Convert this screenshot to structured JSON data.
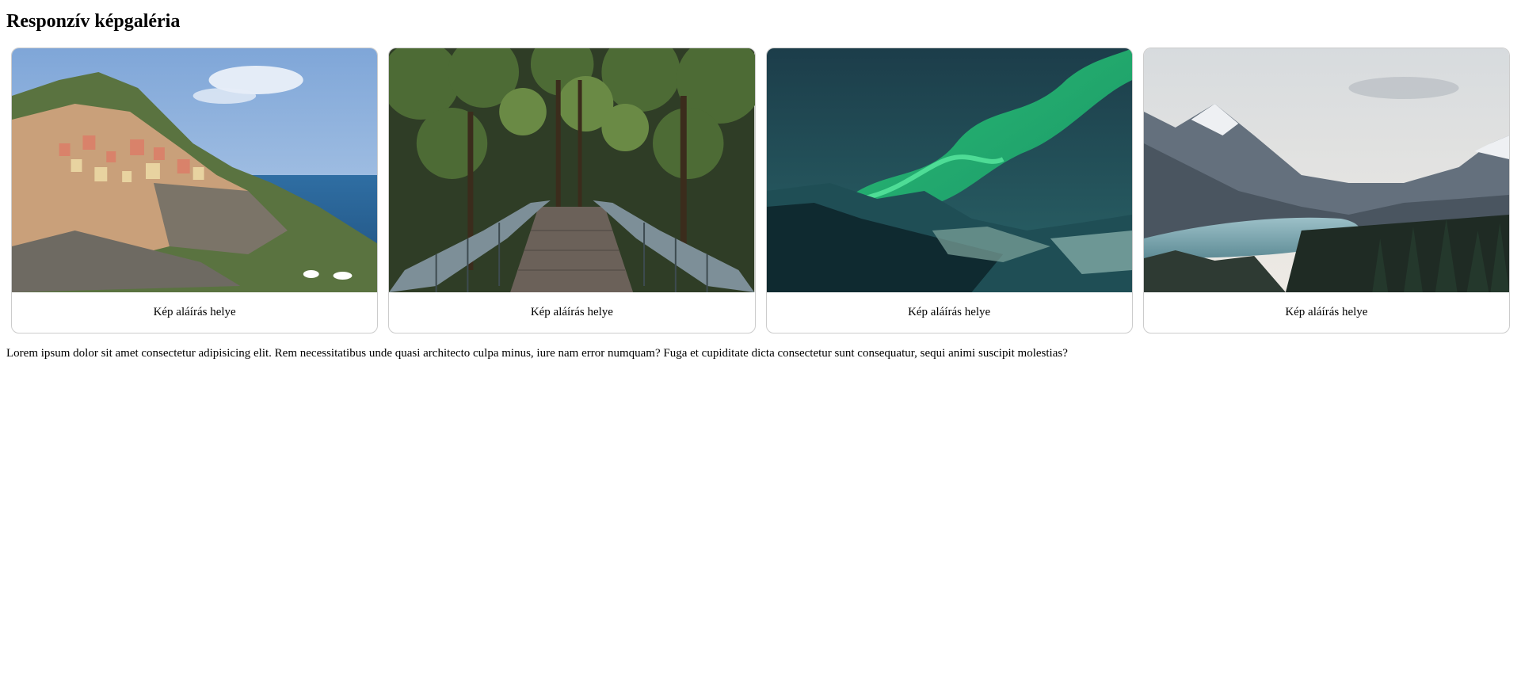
{
  "page": {
    "title": "Responzív képgaléria"
  },
  "gallery": {
    "items": [
      {
        "image": "coastal-village-photo",
        "caption": "Kép aláírás helye"
      },
      {
        "image": "forest-bridge-photo",
        "caption": "Kép aláírás helye"
      },
      {
        "image": "aurora-photo",
        "caption": "Kép aláírás helye"
      },
      {
        "image": "mountain-lake-photo",
        "caption": "Kép aláírás helye"
      }
    ]
  },
  "body_text": "Lorem ipsum dolor sit amet consectetur adipisicing elit. Rem necessitatibus unde quasi architecto culpa minus, iure nam error numquam? Fuga et cupiditate dicta consectetur sunt consequatur, sequi animi suscipit molestias?"
}
